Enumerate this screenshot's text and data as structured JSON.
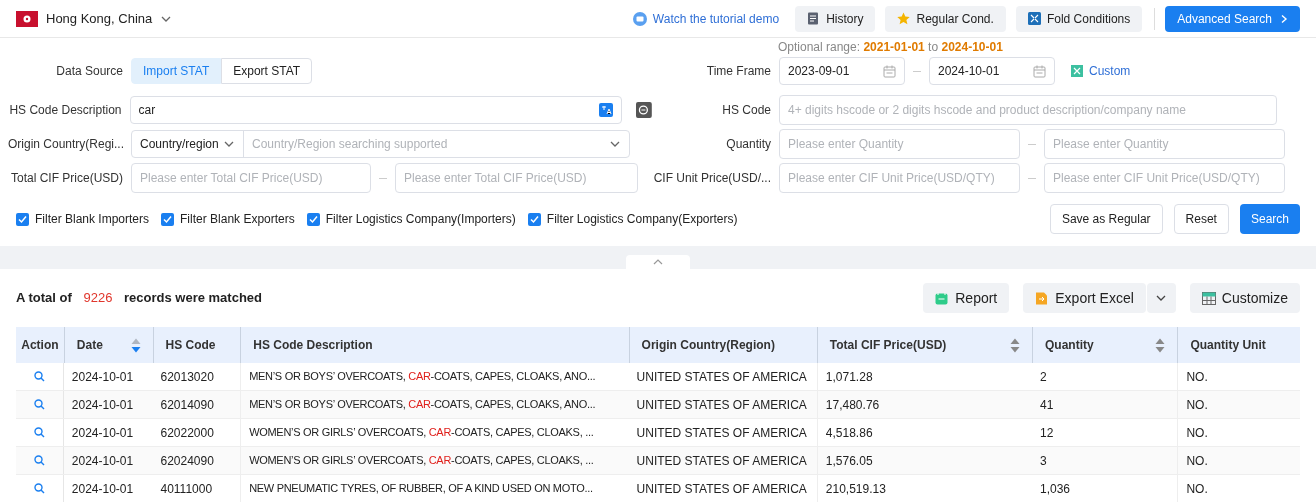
{
  "region": {
    "name": "Hong Kong, China"
  },
  "toolbar": {
    "tutorial": "Watch the tutorial demo",
    "buttons": [
      {
        "kind": "history",
        "label": "History"
      },
      {
        "kind": "regular",
        "label": "Regular Cond."
      },
      {
        "kind": "fold",
        "label": "Fold Conditions"
      }
    ],
    "advanced": "Advanced Search"
  },
  "optional_range": {
    "label": "Optional range:",
    "from": "2021-01-01",
    "to_word": "to",
    "to": "2024-10-01"
  },
  "data_source": {
    "label": "Data Source",
    "tabs": [
      {
        "label": "Import STAT",
        "selected": true
      },
      {
        "label": "Export STAT",
        "selected": false
      }
    ]
  },
  "time_frame": {
    "label": "Time Frame",
    "from": "2023-09-01",
    "to": "2024-10-01",
    "custom": "Custom"
  },
  "hs_description": {
    "label": "HS Code Description",
    "value": "car"
  },
  "hs_code": {
    "label": "HS Code",
    "placeholder": "4+ digits hscode or 2 digits hscode and product description/company name"
  },
  "origin": {
    "label": "Origin Country(Regi...",
    "select": "Country/region",
    "placeholder": "Country/Region searching supported"
  },
  "quantity": {
    "label": "Quantity",
    "min_placeholder": "Please enter Quantity",
    "max_placeholder": "Please enter Quantity"
  },
  "total_cif": {
    "label": "Total CIF Price(USD)",
    "min_placeholder": "Please enter Total CIF Price(USD)",
    "max_placeholder": "Please enter Total CIF Price(USD)"
  },
  "cif_unit": {
    "label": "CIF Unit Price(USD/...",
    "min_placeholder": "Please enter CIF Unit Price(USD/QTY)",
    "max_placeholder": "Please enter CIF Unit Price(USD/QTY)"
  },
  "filters": [
    {
      "label": "Filter Blank Importers",
      "checked": true
    },
    {
      "label": "Filter Blank Exporters",
      "checked": true
    },
    {
      "label": "Filter Logistics Company(Importers)",
      "checked": true
    },
    {
      "label": "Filter Logistics Company(Exporters)",
      "checked": true
    }
  ],
  "actions": [
    "Save as Regular",
    "Reset",
    "Search"
  ],
  "results": {
    "prefix": "A total of",
    "count": "9226",
    "suffix": "records were matched",
    "buttons": [
      {
        "kind": "report",
        "label": "Report"
      },
      {
        "kind": "excel",
        "label": "Export Excel"
      },
      {
        "kind": "customize",
        "label": "Customize"
      }
    ]
  },
  "table": {
    "columns": [
      {
        "label": "Action",
        "sortable": false
      },
      {
        "label": "Date",
        "sortable": true,
        "sorted_descending": true
      },
      {
        "label": "HS Code",
        "sortable": false
      },
      {
        "label": "HS Code Description",
        "sortable": false
      },
      {
        "label": "Origin Country(Region)",
        "sortable": false
      },
      {
        "label": "Total CIF Price(USD)",
        "sortable": true,
        "sorted_descending": false
      },
      {
        "label": "Quantity",
        "sortable": true,
        "sorted_descending": false
      },
      {
        "label": "Quantity Unit",
        "sortable": false
      }
    ],
    "rows": [
      {
        "date": "2024-10-01",
        "hs_code": "62013020",
        "description": {
          "before": "MEN’S OR BOYS’ OVERCOATS, ",
          "match": "CAR",
          "after": "-COATS, CAPES, CLOAKS, ANO..."
        },
        "origin": "UNITED STATES OF AMERICA",
        "total_cif": "1,071.28",
        "quantity": "2",
        "unit": "NO."
      },
      {
        "date": "2024-10-01",
        "hs_code": "62014090",
        "description": {
          "before": "MEN’S OR BOYS’ OVERCOATS, ",
          "match": "CAR",
          "after": "-COATS, CAPES, CLOAKS, ANO..."
        },
        "origin": "UNITED STATES OF AMERICA",
        "total_cif": "17,480.76",
        "quantity": "41",
        "unit": "NO."
      },
      {
        "date": "2024-10-01",
        "hs_code": "62022000",
        "description": {
          "before": "WOMEN’S OR GIRLS’ OVERCOATS, ",
          "match": "CAR",
          "after": "-COATS, CAPES, CLOAKS, ..."
        },
        "origin": "UNITED STATES OF AMERICA",
        "total_cif": "4,518.86",
        "quantity": "12",
        "unit": "NO."
      },
      {
        "date": "2024-10-01",
        "hs_code": "62024090",
        "description": {
          "before": "WOMEN’S OR GIRLS’ OVERCOATS, ",
          "match": "CAR",
          "after": "-COATS, CAPES, CLOAKS, ..."
        },
        "origin": "UNITED STATES OF AMERICA",
        "total_cif": "1,576.05",
        "quantity": "3",
        "unit": "NO."
      },
      {
        "date": "2024-10-01",
        "hs_code": "40111000",
        "description": {
          "before": "NEW PNEUMATIC TYRES, OF RUBBER, OF A KIND USED ON MOTO..."
        },
        "origin": "UNITED STATES OF AMERICA",
        "total_cif": "210,519.13",
        "quantity": "1,036",
        "unit": "NO."
      }
    ]
  }
}
